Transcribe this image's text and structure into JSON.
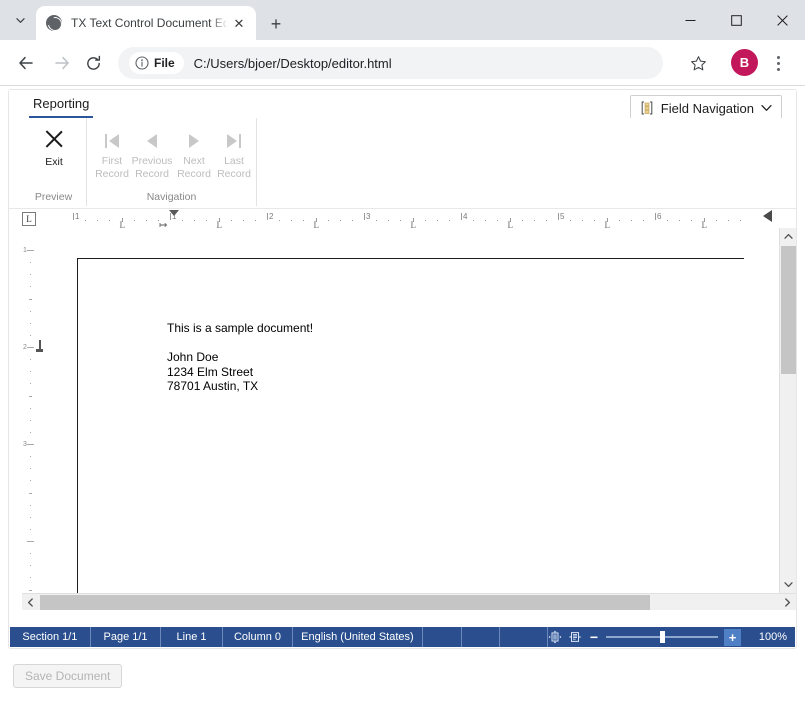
{
  "browser": {
    "tab": {
      "title": "TX Text Control Document Edito",
      "favicon_name": "globe-icon",
      "close_label": "✕"
    },
    "new_tab_label": "+",
    "tab_search_name": "tab-search-chevron-icon",
    "window_controls": {
      "minimize": "−",
      "maximize": "□",
      "close": "✕"
    },
    "toolbar": {
      "back": "←",
      "forward": "→",
      "reload": "↻",
      "file_chip_label": "File",
      "url": "C:/Users/bjoer/Desktop/editor.html",
      "star_name": "bookmark-star-icon",
      "avatar_initial": "B",
      "menu_name": "three-dot-menu-icon"
    },
    "colors": {
      "tabstrip": "#dee1e6",
      "accent": "#2b579a",
      "avatar": "#c2185b"
    }
  },
  "editor": {
    "ribbon": {
      "tabs": [
        {
          "label": "Reporting",
          "active": true
        }
      ],
      "groups": [
        {
          "name": "Preview",
          "label": "Preview",
          "buttons": [
            {
              "label_line1": "Exit",
              "label_line2": "",
              "icon": "close-x-icon",
              "disabled": false
            }
          ]
        },
        {
          "name": "Navigation",
          "label": "Navigation",
          "buttons": [
            {
              "label_line1": "First",
              "label_line2": "Record",
              "icon": "first-record-icon",
              "disabled": true
            },
            {
              "label_line1": "Previous",
              "label_line2": "Record",
              "icon": "previous-record-icon",
              "disabled": true
            },
            {
              "label_line1": "Next",
              "label_line2": "Record",
              "icon": "next-record-icon",
              "disabled": true
            },
            {
              "label_line1": "Last",
              "label_line2": "Record",
              "icon": "last-record-icon",
              "disabled": true
            }
          ]
        }
      ],
      "field_navigation": {
        "label": "Field Navigation",
        "icon": "field-navigation-icon",
        "chevron": "∨"
      },
      "collapse_chevron": "∧"
    },
    "ruler": {
      "corner_marker": "L",
      "horizontal_numbers": [
        "1",
        "1",
        "2",
        "3",
        "4",
        "5",
        "6"
      ],
      "tab_stop_glyph": "L",
      "vertical_numbers": [
        "1",
        "2",
        "3"
      ]
    },
    "document": {
      "title_line": "This is a sample document!",
      "address_lines": [
        "John Doe",
        "1234 Elm Street",
        "78701 Austin, TX"
      ]
    },
    "statusbar": {
      "section": "Section 1/1",
      "page": "Page 1/1",
      "line": "Line 1",
      "column": "Column 0",
      "language": "English (United States)",
      "empty1": "",
      "empty2": "",
      "empty3": "",
      "view_icon_1": "page-view-icon",
      "view_icon_2": "reading-view-icon",
      "zoom_minus": "−",
      "zoom_plus": "+",
      "zoom_percent": "100%",
      "bg_color": "#2b4f8e"
    },
    "scrollbars": {
      "v_up": "∧",
      "v_down": "∨",
      "h_left": "‹",
      "h_right": "›"
    }
  },
  "page_actions": {
    "save_document_label": "Save Document",
    "save_document_disabled": true
  }
}
